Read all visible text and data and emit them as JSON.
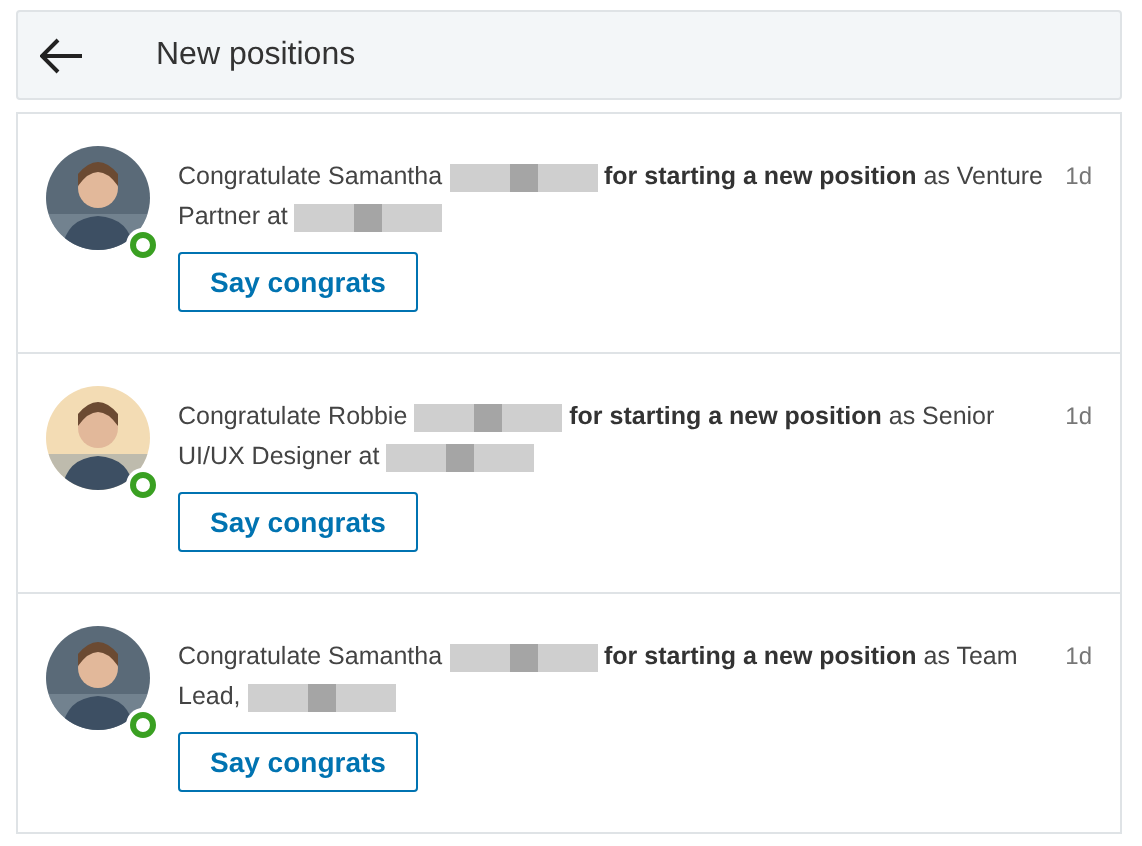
{
  "header": {
    "title": "New positions"
  },
  "notifications": [
    {
      "online": true,
      "segments": [
        {
          "kind": "text",
          "text": "Congratulate Samantha"
        },
        {
          "kind": "redacted"
        },
        {
          "kind": "text",
          "text": "**for starting a new position** as Venture Partner at"
        },
        {
          "kind": "redacted"
        }
      ],
      "time": "1d",
      "button": "Say congrats"
    },
    {
      "online": true,
      "segments": [
        {
          "kind": "text",
          "text": "Congratulate Robbie"
        },
        {
          "kind": "redacted"
        },
        {
          "kind": "text",
          "text": "**for starting a new position** as Senior UI/UX Designer at"
        },
        {
          "kind": "redacted"
        }
      ],
      "time": "1d",
      "button": "Say congrats"
    },
    {
      "online": true,
      "segments": [
        {
          "kind": "text",
          "text": "Congratulate Samantha"
        },
        {
          "kind": "redacted"
        },
        {
          "kind": "text",
          "text": "**for starting a new position** as Team Lead,"
        },
        {
          "kind": "redacted"
        }
      ],
      "time": "1d",
      "button": "Say congrats"
    }
  ]
}
